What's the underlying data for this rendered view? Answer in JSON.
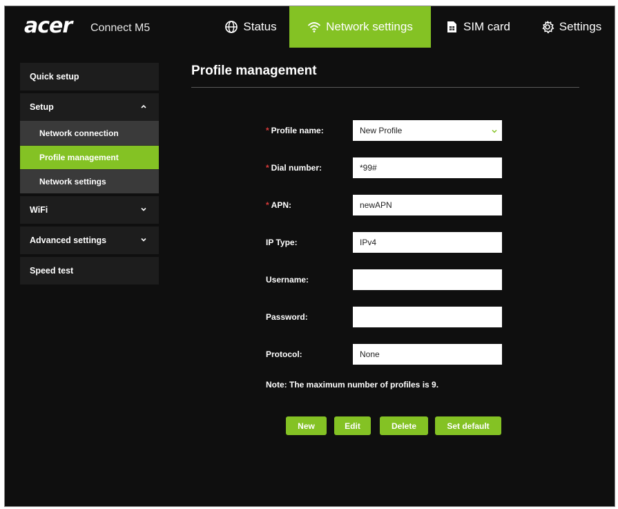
{
  "header": {
    "logo_text": "acer",
    "product_name": "Connect M5",
    "nav": [
      {
        "label": "Status",
        "icon": "globe-icon",
        "active": false
      },
      {
        "label": "Network settings",
        "icon": "wifi-icon",
        "active": true
      },
      {
        "label": "SIM card",
        "icon": "sim-card-icon",
        "active": false
      },
      {
        "label": "Settings",
        "icon": "gear-icon",
        "active": false
      }
    ]
  },
  "sidebar": {
    "items": [
      {
        "label": "Quick setup"
      },
      {
        "label": "Setup",
        "expanded": true,
        "children": [
          {
            "label": "Network connection"
          },
          {
            "label": "Profile management",
            "active": true
          },
          {
            "label": "Network settings"
          }
        ]
      },
      {
        "label": "WiFi",
        "expanded": false
      },
      {
        "label": "Advanced settings",
        "expanded": false
      },
      {
        "label": "Speed test"
      }
    ]
  },
  "main": {
    "title": "Profile management",
    "form": {
      "profile_name": {
        "label": "Profile name:",
        "required": true,
        "value": "New Profile"
      },
      "dial_number": {
        "label": "Dial number:",
        "required": true,
        "value": "*99#"
      },
      "apn": {
        "label": "APN:",
        "required": true,
        "value": "newAPN"
      },
      "ip_type": {
        "label": "IP Type:",
        "required": false,
        "value": "IPv4"
      },
      "username": {
        "label": "Username:",
        "required": false,
        "value": ""
      },
      "password": {
        "label": "Password:",
        "required": false,
        "value": ""
      },
      "protocol": {
        "label": "Protocol:",
        "required": false,
        "value": "None"
      }
    },
    "required_marker": "*",
    "note": "Note: The maximum number of profiles is 9.",
    "buttons": {
      "new": "New",
      "edit": "Edit",
      "delete": "Delete",
      "set_default": "Set default"
    }
  },
  "colors": {
    "accent": "#84c224",
    "background": "#0f0f0f",
    "panel": "#1d1d1d",
    "required": "#d93a3a"
  }
}
